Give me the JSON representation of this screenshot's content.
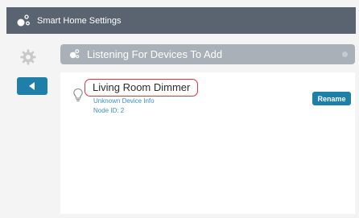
{
  "app": {
    "title": "Smart Home Settings",
    "logo_icon": "devices-logo-icon"
  },
  "sidebar": {
    "settings_icon": "gear-icon",
    "back_icon": "back-arrow-icon"
  },
  "status_bar": {
    "text": "Listening For Devices To Add",
    "icon": "device-search-icon"
  },
  "device": {
    "name": "Living Room Dimmer",
    "info": "Unknown Device Info",
    "node_id": "Node ID: 2",
    "icon": "lightbulb-icon",
    "rename_label": "Rename"
  },
  "colors": {
    "titlebar": "#5a6470",
    "accent": "#1e7fa8",
    "status_bar": "#a9b0b8",
    "highlight": "#d43a3a",
    "link_text": "#3e8fc4"
  }
}
